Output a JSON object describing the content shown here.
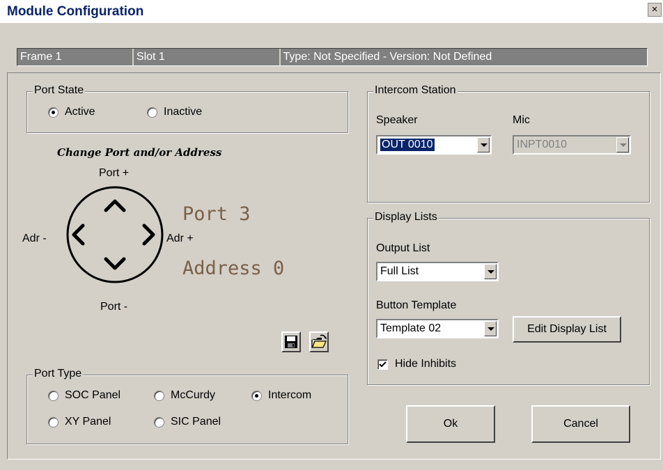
{
  "window": {
    "title": "Module Configuration",
    "close_glyph": "×"
  },
  "status": {
    "frame": "Frame 1",
    "slot": "Slot 1",
    "type_version": "Type: Not Specified    -    Version: Not Defined"
  },
  "port_state": {
    "label": "Port State",
    "options": [
      {
        "label": "Active",
        "selected": true
      },
      {
        "label": "Inactive",
        "selected": false
      }
    ]
  },
  "navigator": {
    "heading": "Change Port and/or Address",
    "port_plus": "Port +",
    "port_minus": "Port -",
    "adr_minus": "Adr -",
    "adr_plus": "Adr +",
    "port_display": "Port 3",
    "address_display": "Address 0"
  },
  "port_type": {
    "label": "Port Type",
    "options": [
      {
        "label": "SOC Panel",
        "selected": false
      },
      {
        "label": "McCurdy",
        "selected": false
      },
      {
        "label": "Intercom",
        "selected": true
      },
      {
        "label": "XY Panel",
        "selected": false
      },
      {
        "label": "SIC Panel",
        "selected": false
      }
    ]
  },
  "intercom": {
    "label": "Intercom Station",
    "speaker_label": "Speaker",
    "speaker_value": "OUT 0010",
    "mic_label": "Mic",
    "mic_value": "INPT0010"
  },
  "display_lists": {
    "label": "Display Lists",
    "output_label": "Output List",
    "output_value": "Full List",
    "template_label": "Button Template",
    "template_value": "Template 02",
    "edit_button": "Edit Display List",
    "hide_inhibits": "Hide Inhibits",
    "hide_inhibits_checked": true
  },
  "buttons": {
    "ok": "Ok",
    "cancel": "Cancel"
  },
  "icons": {
    "save": "save-icon",
    "open": "open-folder-icon"
  },
  "colors": {
    "title_text": "#0a246a",
    "display_text": "#7a6048",
    "status_bg": "#808080"
  }
}
